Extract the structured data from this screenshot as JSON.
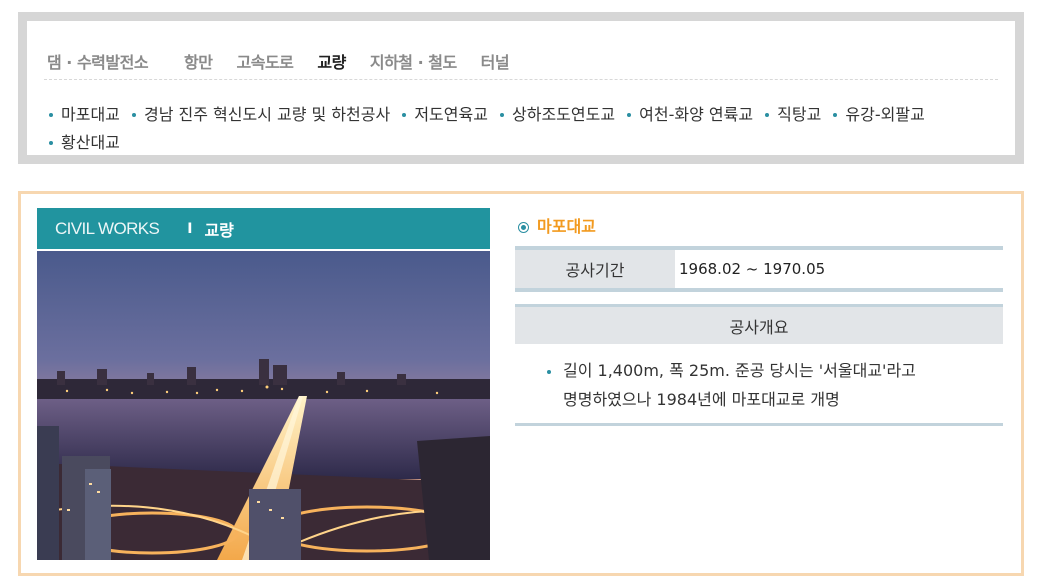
{
  "categories": {
    "tabs": [
      {
        "label": "댐 · 수력발전소",
        "active": false
      },
      {
        "label": "항만",
        "active": false
      },
      {
        "label": "고속도로",
        "active": false
      },
      {
        "label": "교량",
        "active": true
      },
      {
        "label": "지하철 · 철도",
        "active": false
      },
      {
        "label": "터널",
        "active": false
      }
    ],
    "links": [
      "마포대교",
      "경남 진주 혁신도시 교량 및 하천공사",
      "저도연육교",
      "상하조도연도교",
      "여천-화양 연륙교",
      "직탕교",
      "유강-외팔교",
      "황산대교"
    ],
    "bullet_color": "#2a8fa2"
  },
  "banner": {
    "main": "CIVIL WORKS",
    "separator": "I",
    "sub": "교량",
    "color": "#21949f"
  },
  "project": {
    "title": "마포대교",
    "title_color": "#f29a1f",
    "period_label": "공사기간",
    "period_value": "1968.02 ~ 1970.05",
    "overview_label": "공사개요",
    "overview_line1": "길이 1,400m, 폭 25m. 준공 당시는 '서울대교'라고",
    "overview_line2": "명명하였으나 1984년에 마포대교로 개명"
  }
}
